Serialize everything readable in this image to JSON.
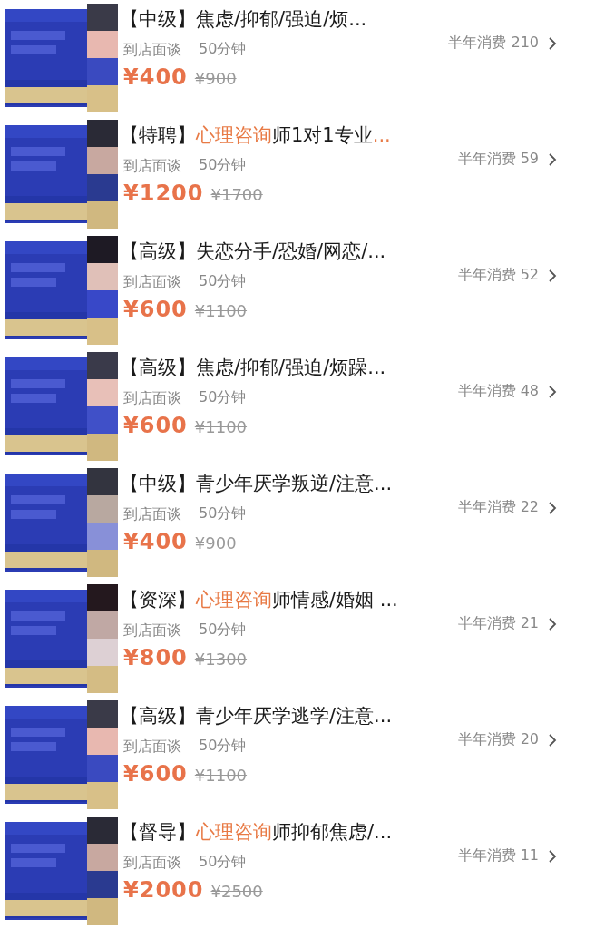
{
  "items": [
    {
      "thumbnail": {
        "kind": "picture"
      },
      "title": [
        {
          "text": "【中级】焦虑/抑郁/强迫/烦...",
          "accent": false
        }
      ],
      "mode": "到店面谈",
      "duration": "50分钟",
      "sales": "半年消费 210",
      "price": "¥400",
      "original_price": "¥900"
    },
    {
      "thumbnail": {
        "kind": "picture"
      },
      "title": [
        {
          "text": "【特聘】",
          "accent": false
        },
        {
          "text": "心理咨询",
          "accent": true
        },
        {
          "text": "师1对1专业",
          "accent": false
        },
        {
          "text": "...",
          "accent": true
        }
      ],
      "mode": "到店面谈",
      "duration": "50分钟",
      "sales": "半年消费 59",
      "price": "¥1200",
      "original_price": "¥1700"
    },
    {
      "thumbnail": {
        "kind": "picture"
      },
      "title": [
        {
          "text": "【高级】失恋分手/恐婚/网恋/...",
          "accent": false
        }
      ],
      "mode": "到店面谈",
      "duration": "50分钟",
      "sales": "半年消费 52",
      "price": "¥600",
      "original_price": "¥1100"
    },
    {
      "thumbnail": {
        "kind": "picture"
      },
      "title": [
        {
          "text": "【高级】焦虑/抑郁/强迫/烦躁...",
          "accent": false
        }
      ],
      "mode": "到店面谈",
      "duration": "50分钟",
      "sales": "半年消费 48",
      "price": "¥600",
      "original_price": "¥1100"
    },
    {
      "thumbnail": {
        "kind": "picture"
      },
      "title": [
        {
          "text": "【中级】青少年厌学叛逆/注意...",
          "accent": false
        }
      ],
      "mode": "到店面谈",
      "duration": "50分钟",
      "sales": "半年消费 22",
      "price": "¥400",
      "original_price": "¥900"
    },
    {
      "thumbnail": {
        "kind": "picture"
      },
      "title": [
        {
          "text": "【资深】",
          "accent": false
        },
        {
          "text": "心理咨询",
          "accent": true
        },
        {
          "text": "师情感/婚姻 ...",
          "accent": false
        }
      ],
      "mode": "到店面谈",
      "duration": "50分钟",
      "sales": "半年消费 21",
      "price": "¥800",
      "original_price": "¥1300"
    },
    {
      "thumbnail": {
        "kind": "picture"
      },
      "title": [
        {
          "text": "【高级】青少年厌学逃学/注意...",
          "accent": false
        }
      ],
      "mode": "到店面谈",
      "duration": "50分钟",
      "sales": "半年消费 20",
      "price": "¥600",
      "original_price": "¥1100"
    },
    {
      "thumbnail": {
        "kind": "picture"
      },
      "title": [
        {
          "text": "【督导】",
          "accent": false
        },
        {
          "text": "心理咨询",
          "accent": true
        },
        {
          "text": "师抑郁焦虑/...",
          "accent": false
        }
      ],
      "mode": "到店面谈",
      "duration": "50分钟",
      "sales": "半年消费 11",
      "price": "¥2000",
      "original_price": "¥2500"
    }
  ]
}
